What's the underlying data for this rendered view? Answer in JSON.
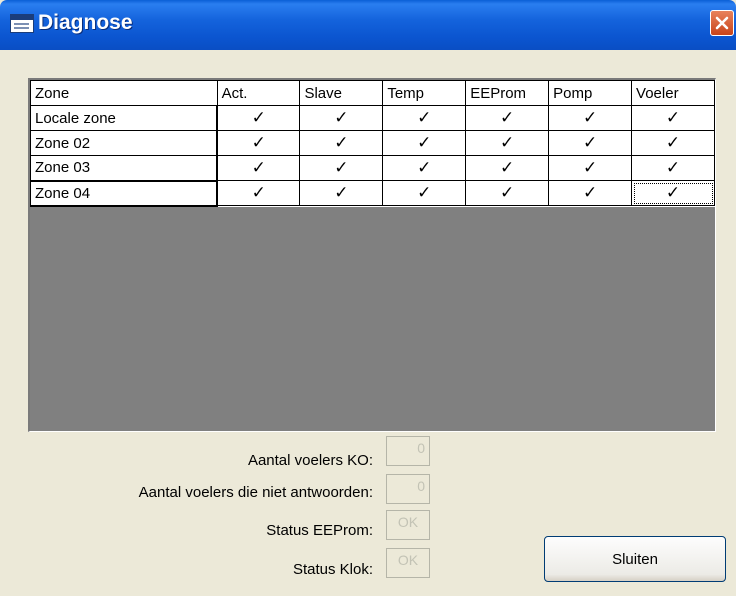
{
  "window": {
    "title": "Diagnose"
  },
  "grid": {
    "columns": [
      "Zone",
      "Act.",
      "Slave",
      "Temp",
      "EEProm",
      "Pomp",
      "Voeler"
    ],
    "rows": [
      {
        "zone": "Locale zone",
        "cells": [
          "✓",
          "✓",
          "✓",
          "✓",
          "✓",
          "✓"
        ]
      },
      {
        "zone": "Zone 02",
        "cells": [
          "✓",
          "✓",
          "✓",
          "✓",
          "✓",
          "✓"
        ]
      },
      {
        "zone": "Zone 03",
        "cells": [
          "✓",
          "✓",
          "✓",
          "✓",
          "✓",
          "✓"
        ]
      },
      {
        "zone": "Zone 04",
        "cells": [
          "✓",
          "✓",
          "✓",
          "✓",
          "✓",
          "✓"
        ]
      }
    ]
  },
  "fields": {
    "voelers_ko": {
      "label": "Aantal voelers KO:",
      "value": "0"
    },
    "voelers_niet": {
      "label": "Aantal voelers die niet antwoorden:",
      "value": "0"
    },
    "status_eeprom": {
      "label": "Status EEProm:",
      "value": "OK"
    },
    "status_klok": {
      "label": "Status Klok:",
      "value": "OK"
    }
  },
  "buttons": {
    "close": "Sluiten"
  }
}
